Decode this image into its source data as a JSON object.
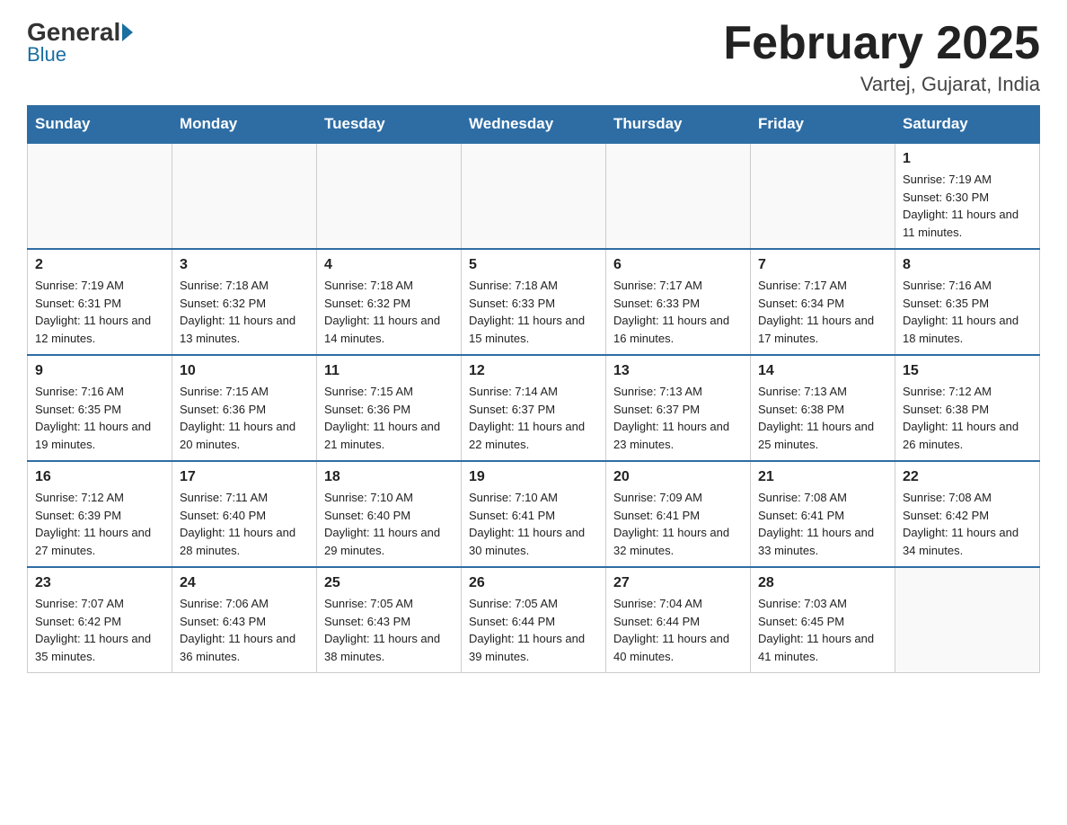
{
  "header": {
    "logo_general": "General",
    "logo_blue": "Blue",
    "month_title": "February 2025",
    "location": "Vartej, Gujarat, India"
  },
  "weekdays": [
    "Sunday",
    "Monday",
    "Tuesday",
    "Wednesday",
    "Thursday",
    "Friday",
    "Saturday"
  ],
  "weeks": [
    [
      {
        "day": "",
        "sunrise": "",
        "sunset": "",
        "daylight": ""
      },
      {
        "day": "",
        "sunrise": "",
        "sunset": "",
        "daylight": ""
      },
      {
        "day": "",
        "sunrise": "",
        "sunset": "",
        "daylight": ""
      },
      {
        "day": "",
        "sunrise": "",
        "sunset": "",
        "daylight": ""
      },
      {
        "day": "",
        "sunrise": "",
        "sunset": "",
        "daylight": ""
      },
      {
        "day": "",
        "sunrise": "",
        "sunset": "",
        "daylight": ""
      },
      {
        "day": "1",
        "sunrise": "Sunrise: 7:19 AM",
        "sunset": "Sunset: 6:30 PM",
        "daylight": "Daylight: 11 hours and 11 minutes."
      }
    ],
    [
      {
        "day": "2",
        "sunrise": "Sunrise: 7:19 AM",
        "sunset": "Sunset: 6:31 PM",
        "daylight": "Daylight: 11 hours and 12 minutes."
      },
      {
        "day": "3",
        "sunrise": "Sunrise: 7:18 AM",
        "sunset": "Sunset: 6:32 PM",
        "daylight": "Daylight: 11 hours and 13 minutes."
      },
      {
        "day": "4",
        "sunrise": "Sunrise: 7:18 AM",
        "sunset": "Sunset: 6:32 PM",
        "daylight": "Daylight: 11 hours and 14 minutes."
      },
      {
        "day": "5",
        "sunrise": "Sunrise: 7:18 AM",
        "sunset": "Sunset: 6:33 PM",
        "daylight": "Daylight: 11 hours and 15 minutes."
      },
      {
        "day": "6",
        "sunrise": "Sunrise: 7:17 AM",
        "sunset": "Sunset: 6:33 PM",
        "daylight": "Daylight: 11 hours and 16 minutes."
      },
      {
        "day": "7",
        "sunrise": "Sunrise: 7:17 AM",
        "sunset": "Sunset: 6:34 PM",
        "daylight": "Daylight: 11 hours and 17 minutes."
      },
      {
        "day": "8",
        "sunrise": "Sunrise: 7:16 AM",
        "sunset": "Sunset: 6:35 PM",
        "daylight": "Daylight: 11 hours and 18 minutes."
      }
    ],
    [
      {
        "day": "9",
        "sunrise": "Sunrise: 7:16 AM",
        "sunset": "Sunset: 6:35 PM",
        "daylight": "Daylight: 11 hours and 19 minutes."
      },
      {
        "day": "10",
        "sunrise": "Sunrise: 7:15 AM",
        "sunset": "Sunset: 6:36 PM",
        "daylight": "Daylight: 11 hours and 20 minutes."
      },
      {
        "day": "11",
        "sunrise": "Sunrise: 7:15 AM",
        "sunset": "Sunset: 6:36 PM",
        "daylight": "Daylight: 11 hours and 21 minutes."
      },
      {
        "day": "12",
        "sunrise": "Sunrise: 7:14 AM",
        "sunset": "Sunset: 6:37 PM",
        "daylight": "Daylight: 11 hours and 22 minutes."
      },
      {
        "day": "13",
        "sunrise": "Sunrise: 7:13 AM",
        "sunset": "Sunset: 6:37 PM",
        "daylight": "Daylight: 11 hours and 23 minutes."
      },
      {
        "day": "14",
        "sunrise": "Sunrise: 7:13 AM",
        "sunset": "Sunset: 6:38 PM",
        "daylight": "Daylight: 11 hours and 25 minutes."
      },
      {
        "day": "15",
        "sunrise": "Sunrise: 7:12 AM",
        "sunset": "Sunset: 6:38 PM",
        "daylight": "Daylight: 11 hours and 26 minutes."
      }
    ],
    [
      {
        "day": "16",
        "sunrise": "Sunrise: 7:12 AM",
        "sunset": "Sunset: 6:39 PM",
        "daylight": "Daylight: 11 hours and 27 minutes."
      },
      {
        "day": "17",
        "sunrise": "Sunrise: 7:11 AM",
        "sunset": "Sunset: 6:40 PM",
        "daylight": "Daylight: 11 hours and 28 minutes."
      },
      {
        "day": "18",
        "sunrise": "Sunrise: 7:10 AM",
        "sunset": "Sunset: 6:40 PM",
        "daylight": "Daylight: 11 hours and 29 minutes."
      },
      {
        "day": "19",
        "sunrise": "Sunrise: 7:10 AM",
        "sunset": "Sunset: 6:41 PM",
        "daylight": "Daylight: 11 hours and 30 minutes."
      },
      {
        "day": "20",
        "sunrise": "Sunrise: 7:09 AM",
        "sunset": "Sunset: 6:41 PM",
        "daylight": "Daylight: 11 hours and 32 minutes."
      },
      {
        "day": "21",
        "sunrise": "Sunrise: 7:08 AM",
        "sunset": "Sunset: 6:41 PM",
        "daylight": "Daylight: 11 hours and 33 minutes."
      },
      {
        "day": "22",
        "sunrise": "Sunrise: 7:08 AM",
        "sunset": "Sunset: 6:42 PM",
        "daylight": "Daylight: 11 hours and 34 minutes."
      }
    ],
    [
      {
        "day": "23",
        "sunrise": "Sunrise: 7:07 AM",
        "sunset": "Sunset: 6:42 PM",
        "daylight": "Daylight: 11 hours and 35 minutes."
      },
      {
        "day": "24",
        "sunrise": "Sunrise: 7:06 AM",
        "sunset": "Sunset: 6:43 PM",
        "daylight": "Daylight: 11 hours and 36 minutes."
      },
      {
        "day": "25",
        "sunrise": "Sunrise: 7:05 AM",
        "sunset": "Sunset: 6:43 PM",
        "daylight": "Daylight: 11 hours and 38 minutes."
      },
      {
        "day": "26",
        "sunrise": "Sunrise: 7:05 AM",
        "sunset": "Sunset: 6:44 PM",
        "daylight": "Daylight: 11 hours and 39 minutes."
      },
      {
        "day": "27",
        "sunrise": "Sunrise: 7:04 AM",
        "sunset": "Sunset: 6:44 PM",
        "daylight": "Daylight: 11 hours and 40 minutes."
      },
      {
        "day": "28",
        "sunrise": "Sunrise: 7:03 AM",
        "sunset": "Sunset: 6:45 PM",
        "daylight": "Daylight: 11 hours and 41 minutes."
      },
      {
        "day": "",
        "sunrise": "",
        "sunset": "",
        "daylight": ""
      }
    ]
  ]
}
